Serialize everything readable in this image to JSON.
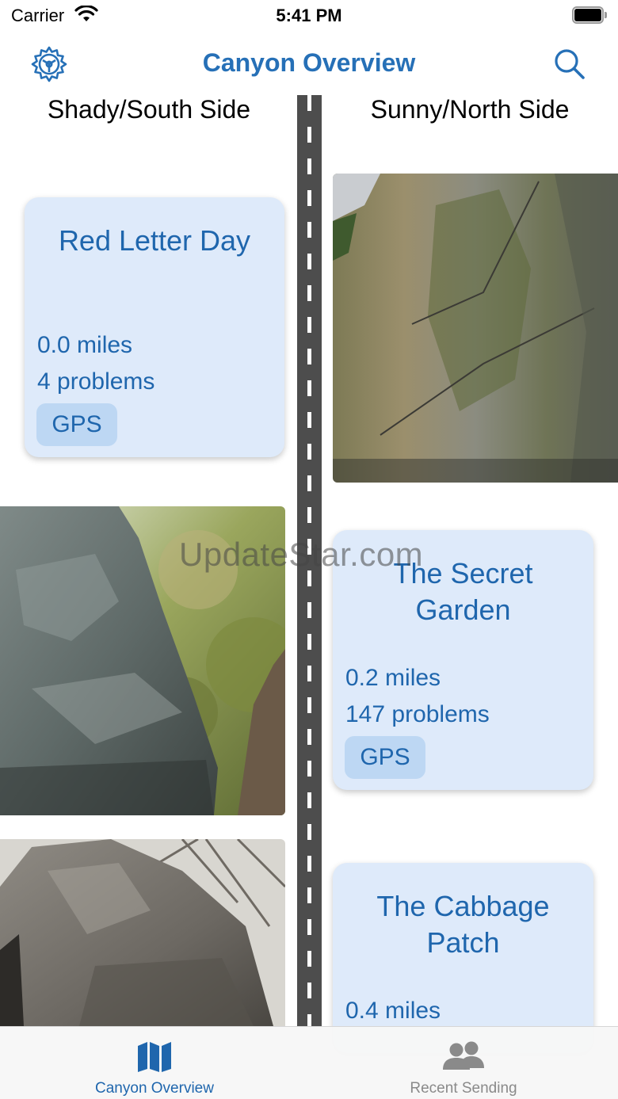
{
  "status": {
    "carrier": "Carrier",
    "time": "5:41 PM",
    "battery_level": 1.0
  },
  "nav": {
    "title": "Canyon Overview",
    "left_icon": "gear-icon",
    "right_icon": "search-icon",
    "accent_color": "#2670b7"
  },
  "sides": {
    "left_heading": "Shady/South Side",
    "right_heading": "Sunny/North Side"
  },
  "areas": [
    {
      "name": "Red Letter Day",
      "distance": "0.0 miles",
      "problems": "4 problems",
      "gps_label": "GPS"
    },
    {
      "name": "The Secret Garden",
      "distance": "0.2 miles",
      "problems": "147 problems",
      "gps_label": "GPS"
    },
    {
      "name": "The Cabbage Patch",
      "distance": "0.4 miles"
    }
  ],
  "watermark": "UpdateStar.com",
  "tabs": [
    {
      "label": "Canyon Overview",
      "icon": "map-icon",
      "selected": true
    },
    {
      "label": "Recent Sending",
      "icon": "people-icon",
      "selected": false
    }
  ],
  "colors": {
    "card_background": "#deeafa",
    "card_text": "#1f66ad",
    "gps_button": "#bdd7f3",
    "road": "#4d4d4d"
  }
}
